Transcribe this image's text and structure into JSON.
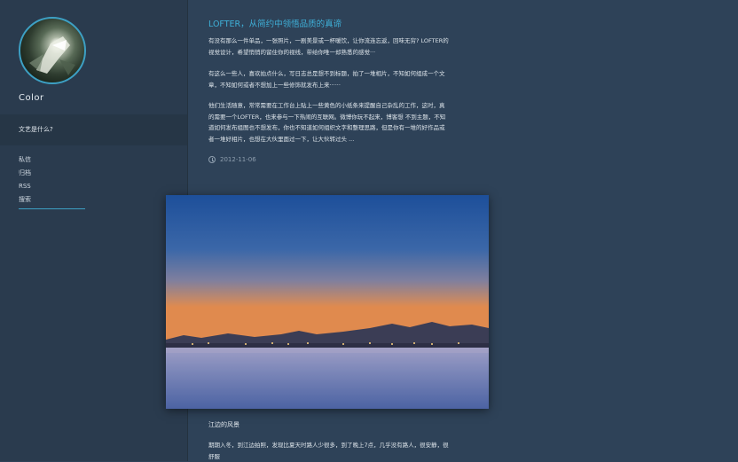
{
  "sidebar": {
    "blog_name": "Color",
    "description": "文艺是什么?",
    "nav": [
      {
        "label": "私信"
      },
      {
        "label": "归档"
      },
      {
        "label": "RSS"
      },
      {
        "label": "搜索"
      }
    ]
  },
  "post": {
    "title": "LOFTER，从简约中领悟品质的真谛",
    "paragraphs": [
      "有没有那么一件单品，一张照片，一剧美景或一杯暖饮，让你流连忘返，回味无穷? LOFTER的视觉设计，希望悄悄的留住你的视线，带给你唯一却熟悉的感觉···",
      "有这么一些人，喜欢拍点什么，写日志总是想不到标题，拍了一堆相片，不知如何组成一个文章，不知如何或者不想加上一些修饰就发布上来······",
      "他们生活随意，常常需要在工作台上贴上一些黄色的小纸条来提醒自己杂乱的工作，这时，真的需要一个LOFTER，也来参与一下热闹的互联网。微博你玩不起来，博客想 不到主题，不知道如何发布组图也不想发布，你也不知道如何组织文字和整理思路，但是你有一堆的好作品或者一堆好相片，也想在大伙里面过一下，让大伙转过头 ..."
    ],
    "date": "2012-11-06",
    "photo_caption": "江边的风景",
    "photo_paragraph": "期期入冬，到江边拍照，发现比夏天时路人少很多，到了晚上7点，几乎没有路人，很安静，很舒服"
  },
  "icons": {
    "date": "clock-icon"
  },
  "colors": {
    "accent": "#3fb0d8",
    "background": "#2e4258",
    "sidebar": "#2a3b4e"
  }
}
